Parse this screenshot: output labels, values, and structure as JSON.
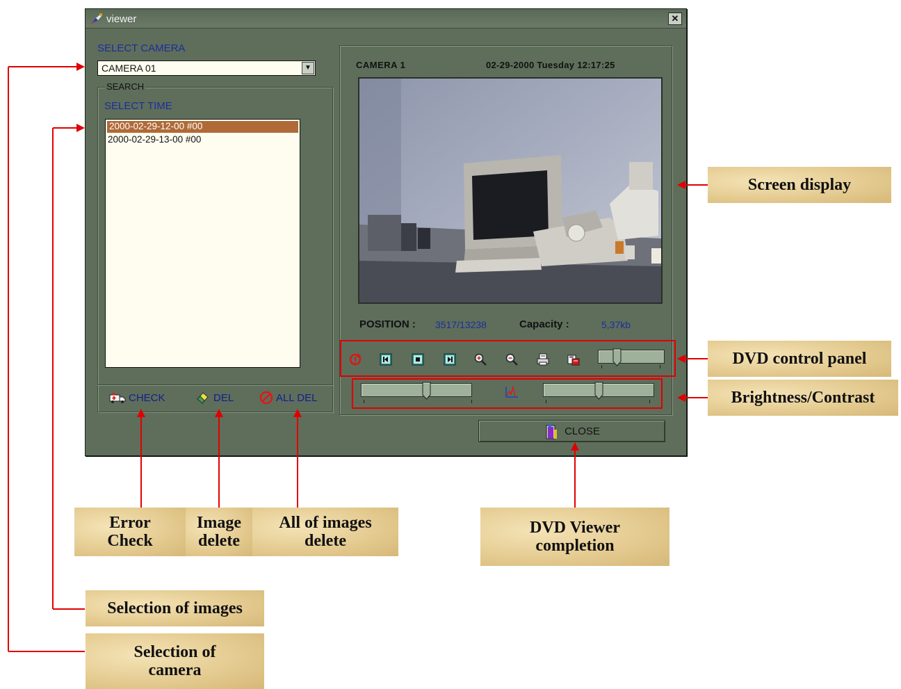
{
  "window": {
    "title": "viewer",
    "close_glyph": "✕"
  },
  "camera": {
    "label": "SELECT CAMERA",
    "selected": "CAMERA 01"
  },
  "search": {
    "legend": "SEARCH",
    "time_label": "SELECT TIME",
    "times": [
      "2000-02-29-12-00 #00",
      "2000-02-29-13-00 #00"
    ],
    "selected_index": 0
  },
  "actions": {
    "check": "CHECK",
    "del": "DEL",
    "all_del": "ALL DEL"
  },
  "display": {
    "camera_name": "CAMERA 1",
    "datetime": "02-29-2000 Tuesday 12:17:25",
    "position_label": "POSITION :",
    "position_value": "3517/13238",
    "capacity_label": "Capacity :",
    "capacity_value": "5,37kb"
  },
  "controls": {
    "icons": [
      "refresh-icon",
      "rewind-icon",
      "stop-icon",
      "forward-icon",
      "zoom-in-icon",
      "zoom-out-icon",
      "print-icon",
      "save-icon"
    ],
    "speed_level": 0.25,
    "brightness_level": 0.6,
    "contrast_level": 0.5
  },
  "close_label": "CLOSE",
  "annotations": {
    "screen_display": "Screen display",
    "dvd_control_panel": "DVD control panel",
    "brightness_contrast": "Brightness/Contrast",
    "error_check": "Error Check",
    "image_delete": "Image delete",
    "all_images_delete": "All of images delete",
    "dvd_viewer_completion": "DVD Viewer completion",
    "selection_of_images": "Selection of images",
    "selection_of_camera": "Selection of camera"
  },
  "colors": {
    "window": "#5e6e5b",
    "label_blue": "#1c2e9a",
    "selection": "#b06a38",
    "annotation_red": "#e00000"
  }
}
